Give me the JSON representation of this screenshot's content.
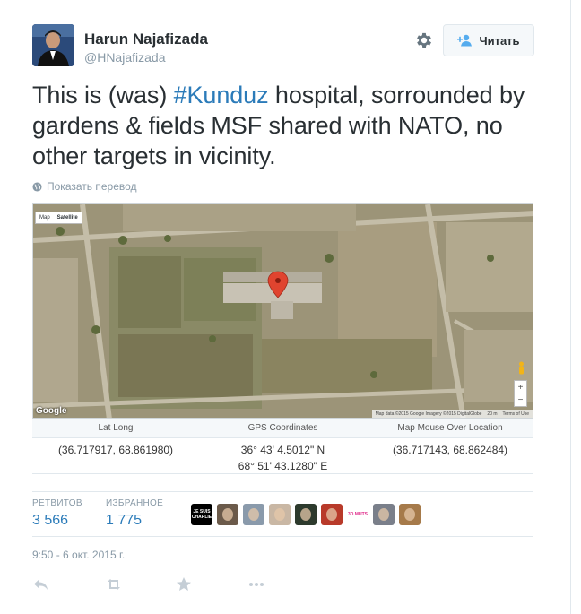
{
  "user": {
    "name": "Harun Najafizada",
    "handle": "@HNajafizada"
  },
  "follow_button": {
    "label": "Читать",
    "icon": "add-user-icon"
  },
  "settings_icon": "gear-icon",
  "tweet": {
    "text_before": "This is (was) ",
    "hashtag": "#Kunduz",
    "text_after": " hospital, sorrounded by gardens & fields MSF shared with NATO, no other targets in vicinity."
  },
  "translate": {
    "label": "Показать перевод",
    "icon": "globe-icon"
  },
  "map": {
    "tabs": [
      "Map",
      "Satellite"
    ],
    "active_tab": "Satellite",
    "logo": "Google",
    "footer": [
      "Map data ©2015 Google Imagery ©2015 DigitalGlobe",
      "20 m",
      "Terms of Use"
    ],
    "zoom_in": "+",
    "zoom_out": "−"
  },
  "coords": {
    "latlong_header": "Lat Long",
    "latlong_value": "(36.717917, 68.861980)",
    "gps_header": "GPS Coordinates",
    "gps_line1": "36° 43' 4.5012\" N",
    "gps_line2": "68° 51' 43.1280\" E",
    "mouse_header": "Map Mouse Over Location",
    "mouse_value": "(36.717143, 68.862484)"
  },
  "stats": {
    "retweets_label": "РЕТВИТОВ",
    "retweets_count": "3 566",
    "likes_label": "ИЗБРАННОЕ",
    "likes_count": "1 775"
  },
  "avatars": [
    {
      "label": "JE SUIS CHARLIE",
      "color": "#000000"
    },
    {
      "label": "",
      "color": "#6b5a4a"
    },
    {
      "label": "",
      "color": "#8a9aab"
    },
    {
      "label": "",
      "color": "#c9b7a4"
    },
    {
      "label": "",
      "color": "#2d3a2d"
    },
    {
      "label": "",
      "color": "#b83a2a"
    },
    {
      "label": "3D MUTS",
      "color": "#ffffff"
    },
    {
      "label": "",
      "color": "#7a7f8a"
    },
    {
      "label": "",
      "color": "#a67a4a"
    }
  ],
  "timestamp": "9:50 - 6 окт. 2015 г.",
  "actions": [
    "reply-icon",
    "retweet-icon",
    "favorite-icon",
    "more-icon"
  ]
}
